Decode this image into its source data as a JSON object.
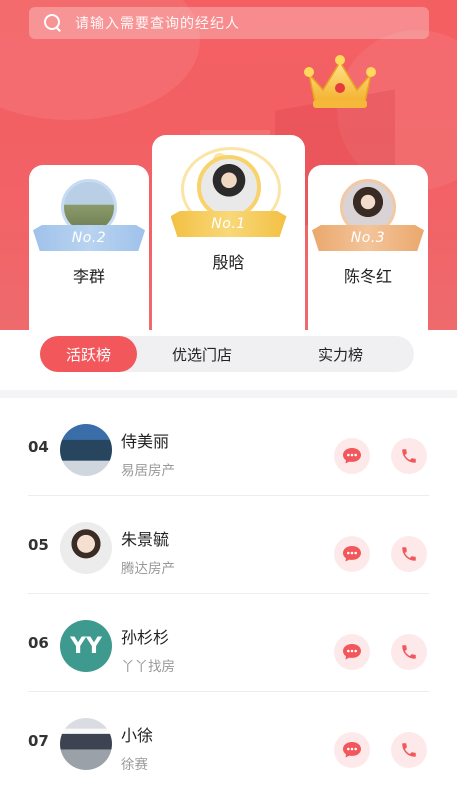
{
  "search": {
    "placeholder": "请输入需要查询的经纪人"
  },
  "podium": [
    {
      "rank_label": "No.2",
      "name": "李群",
      "avatar_icon": "landscape-photo-avatar"
    },
    {
      "rank_label": "No.1",
      "name": "殷晗",
      "avatar_icon": "person-photo-avatar"
    },
    {
      "rank_label": "No.3",
      "name": "陈冬红",
      "avatar_icon": "person-photo-avatar"
    }
  ],
  "tabs": [
    {
      "label": "活跃榜",
      "active": true
    },
    {
      "label": "优选门店",
      "active": false
    },
    {
      "label": "实力榜",
      "active": false
    }
  ],
  "agents": [
    {
      "rank": "04",
      "name": "侍美丽",
      "company": "易居房产"
    },
    {
      "rank": "05",
      "name": "朱景毓",
      "company": "腾达房产"
    },
    {
      "rank": "06",
      "name": "孙杉杉",
      "company": "丫丫找房",
      "logo_text": "YY"
    },
    {
      "rank": "07",
      "name": "小徐",
      "company": "徐赛"
    }
  ],
  "colors": {
    "primary": "#f2575b",
    "gold": "#f8d36b",
    "silver": "#9fc2ea",
    "bronze": "#eaa86c",
    "action_bg": "#fde9ea"
  },
  "icons": {
    "chat": "chat-bubble-icon",
    "call": "phone-icon",
    "search": "search-icon",
    "crown": "crown-icon"
  }
}
